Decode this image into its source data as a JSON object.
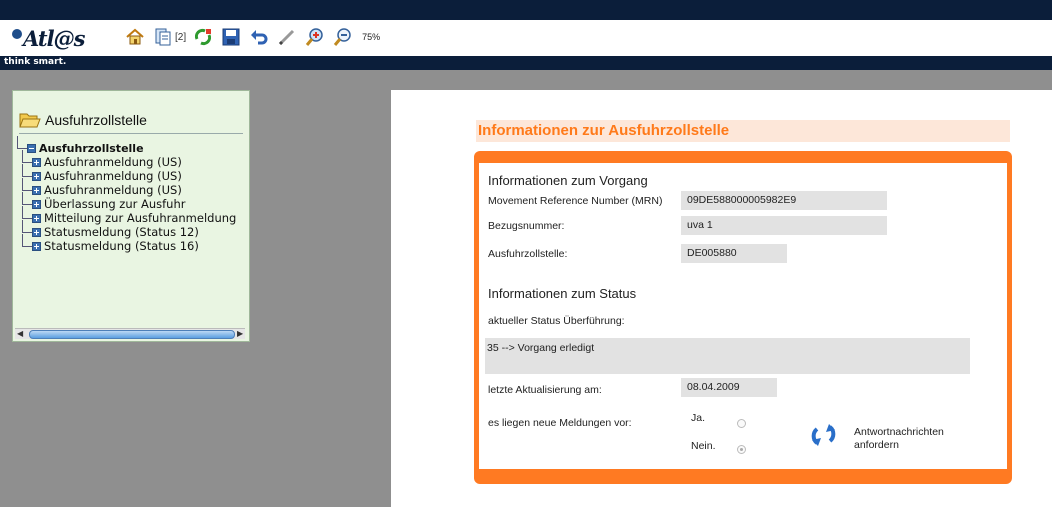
{
  "app": {
    "logo": "Atl@s",
    "slogan": "think smart."
  },
  "toolbar": {
    "page_count": "[2]",
    "zoom": "75%",
    "icons": [
      "home-icon",
      "documents-icon",
      "recycle-icon",
      "save-icon",
      "undo-icon",
      "edit-icon",
      "zoom-in-icon",
      "zoom-out-icon"
    ]
  },
  "tree": {
    "panel_title": "Ausfuhrzollstelle",
    "root": "Ausfuhrzollstelle",
    "items": [
      {
        "label": "Ausfuhranmeldung  (US)"
      },
      {
        "label": "Ausfuhranmeldung  (US)"
      },
      {
        "label": "Ausfuhranmeldung  (US)"
      },
      {
        "label": "Überlassung zur Ausfuhr"
      },
      {
        "label": "Mitteilung zur Ausfuhranmeldung"
      },
      {
        "label": "Statusmeldung (Status 12)"
      },
      {
        "label": "Statusmeldung (Status 16)"
      }
    ]
  },
  "content": {
    "title": "Informationen zur Ausfuhrzollstelle",
    "vorgang": {
      "heading": "Informationen zum Vorgang",
      "mrn_label": "Movement Reference Number (MRN)",
      "mrn_value": "09DE588000005982E9",
      "bezug_label": "Bezugsnummer:",
      "bezug_value": "uva 1",
      "zollstelle_label": "Ausfuhrzollstelle:",
      "zollstelle_value": "DE005880"
    },
    "status": {
      "heading": "Informationen zum Status",
      "current_label": "aktueller Status Überführung:",
      "current_value": "35 --> Vorgang erledigt",
      "updated_label": "letzte Aktualisierung am:",
      "updated_value": "08.04.2009",
      "new_msgs_label": "es liegen neue Meldungen vor:",
      "yes_label": "Ja.",
      "no_label": "Nein.",
      "selected": "Nein.",
      "request_label": "Antwortnachrichten anfordern"
    }
  },
  "colors": {
    "navy": "#0b1e3a",
    "accent_orange": "#ff7a22",
    "header_bg": "#fde7d9",
    "tree_bg": "#e9f5e2"
  }
}
